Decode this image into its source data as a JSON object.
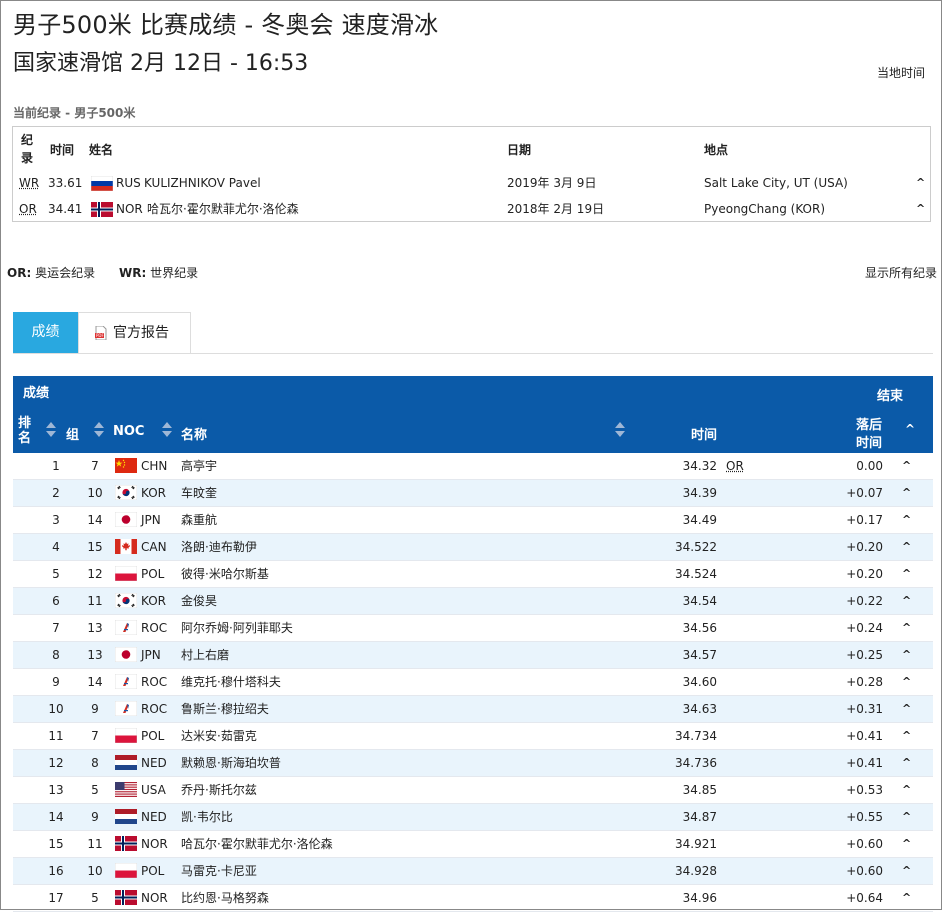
{
  "header": {
    "title": "男子500米 比赛成绩 - 冬奥会 速度滑冰",
    "subtitle": "国家速滑馆 2月 12日 - 16:53",
    "local_time": "当地时间"
  },
  "records": {
    "heading": "当前纪录 - 男子500米",
    "columns": {
      "type": "纪录",
      "time": "时间",
      "name": "姓名",
      "date": "日期",
      "place": "地点"
    },
    "rows": [
      {
        "type": "WR",
        "time": "33.61",
        "noc": "RUS",
        "flag": "rus",
        "name": "KULIZHNIKOV Pavel",
        "date": "2019年 3月 9日",
        "place": "Salt Lake City, UT (USA)"
      },
      {
        "type": "OR",
        "time": "34.41",
        "noc": "NOR",
        "flag": "nor",
        "name": "哈瓦尔·霍尔默菲尤尔·洛伦森",
        "date": "2018年 2月 19日",
        "place": "PyeongChang (KOR)"
      }
    ]
  },
  "legend": {
    "or": "OR:",
    "or_text": "奥运会纪录",
    "wr": "WR:",
    "wr_text": "世界纪录",
    "show_all": "显示所有纪录"
  },
  "tabs": {
    "results": "成绩",
    "report": "官方报告"
  },
  "table": {
    "caption": "成绩",
    "status": "结束",
    "columns": {
      "rank": "排名",
      "group": "组",
      "noc": "NOC",
      "name": "名称",
      "time": "时间",
      "behind_1": "落后",
      "behind_2": "时间"
    },
    "rows": [
      {
        "rank": "1",
        "group": "7",
        "flag": "chn",
        "noc": "CHN",
        "name": "高亭宇",
        "time": "34.32",
        "record": "OR",
        "behind": "0.00"
      },
      {
        "rank": "2",
        "group": "10",
        "flag": "kor",
        "noc": "KOR",
        "name": "车旼奎",
        "time": "34.39",
        "record": "",
        "behind": "+0.07"
      },
      {
        "rank": "3",
        "group": "14",
        "flag": "jpn",
        "noc": "JPN",
        "name": "森重航",
        "time": "34.49",
        "record": "",
        "behind": "+0.17"
      },
      {
        "rank": "4",
        "group": "15",
        "flag": "can",
        "noc": "CAN",
        "name": "洛朗·迪布勒伊",
        "time": "34.522",
        "record": "",
        "behind": "+0.20"
      },
      {
        "rank": "5",
        "group": "12",
        "flag": "pol",
        "noc": "POL",
        "name": "彼得·米哈尔斯基",
        "time": "34.524",
        "record": "",
        "behind": "+0.20"
      },
      {
        "rank": "6",
        "group": "11",
        "flag": "kor",
        "noc": "KOR",
        "name": "金俊昊",
        "time": "34.54",
        "record": "",
        "behind": "+0.22"
      },
      {
        "rank": "7",
        "group": "13",
        "flag": "roc",
        "noc": "ROC",
        "name": "阿尔乔姆·阿列菲耶夫",
        "time": "34.56",
        "record": "",
        "behind": "+0.24"
      },
      {
        "rank": "8",
        "group": "13",
        "flag": "jpn",
        "noc": "JPN",
        "name": "村上右磨",
        "time": "34.57",
        "record": "",
        "behind": "+0.25"
      },
      {
        "rank": "9",
        "group": "14",
        "flag": "roc",
        "noc": "ROC",
        "name": "维克托·穆什塔科夫",
        "time": "34.60",
        "record": "",
        "behind": "+0.28"
      },
      {
        "rank": "10",
        "group": "9",
        "flag": "roc",
        "noc": "ROC",
        "name": "鲁斯兰·穆拉绍夫",
        "time": "34.63",
        "record": "",
        "behind": "+0.31"
      },
      {
        "rank": "11",
        "group": "7",
        "flag": "pol",
        "noc": "POL",
        "name": "达米安·茹雷克",
        "time": "34.734",
        "record": "",
        "behind": "+0.41"
      },
      {
        "rank": "12",
        "group": "8",
        "flag": "ned",
        "noc": "NED",
        "name": "默赖恩·斯海珀坎普",
        "time": "34.736",
        "record": "",
        "behind": "+0.41"
      },
      {
        "rank": "13",
        "group": "5",
        "flag": "usa",
        "noc": "USA",
        "name": "乔丹·斯托尔兹",
        "time": "34.85",
        "record": "",
        "behind": "+0.53"
      },
      {
        "rank": "14",
        "group": "9",
        "flag": "ned",
        "noc": "NED",
        "name": "凯·韦尔比",
        "time": "34.87",
        "record": "",
        "behind": "+0.55"
      },
      {
        "rank": "15",
        "group": "11",
        "flag": "nor",
        "noc": "NOR",
        "name": "哈瓦尔·霍尔默菲尤尔·洛伦森",
        "time": "34.921",
        "record": "",
        "behind": "+0.60"
      },
      {
        "rank": "16",
        "group": "10",
        "flag": "pol",
        "noc": "POL",
        "name": "马雷克·卡尼亚",
        "time": "34.928",
        "record": "",
        "behind": "+0.60"
      },
      {
        "rank": "17",
        "group": "5",
        "flag": "nor",
        "noc": "NOR",
        "name": "比约恩·马格努森",
        "time": "34.96",
        "record": "",
        "behind": "+0.64"
      }
    ]
  },
  "colors": {
    "header_blue": "#0b5aa8",
    "tab_active": "#29a8e0",
    "row_alt": "#e9f4fc"
  }
}
